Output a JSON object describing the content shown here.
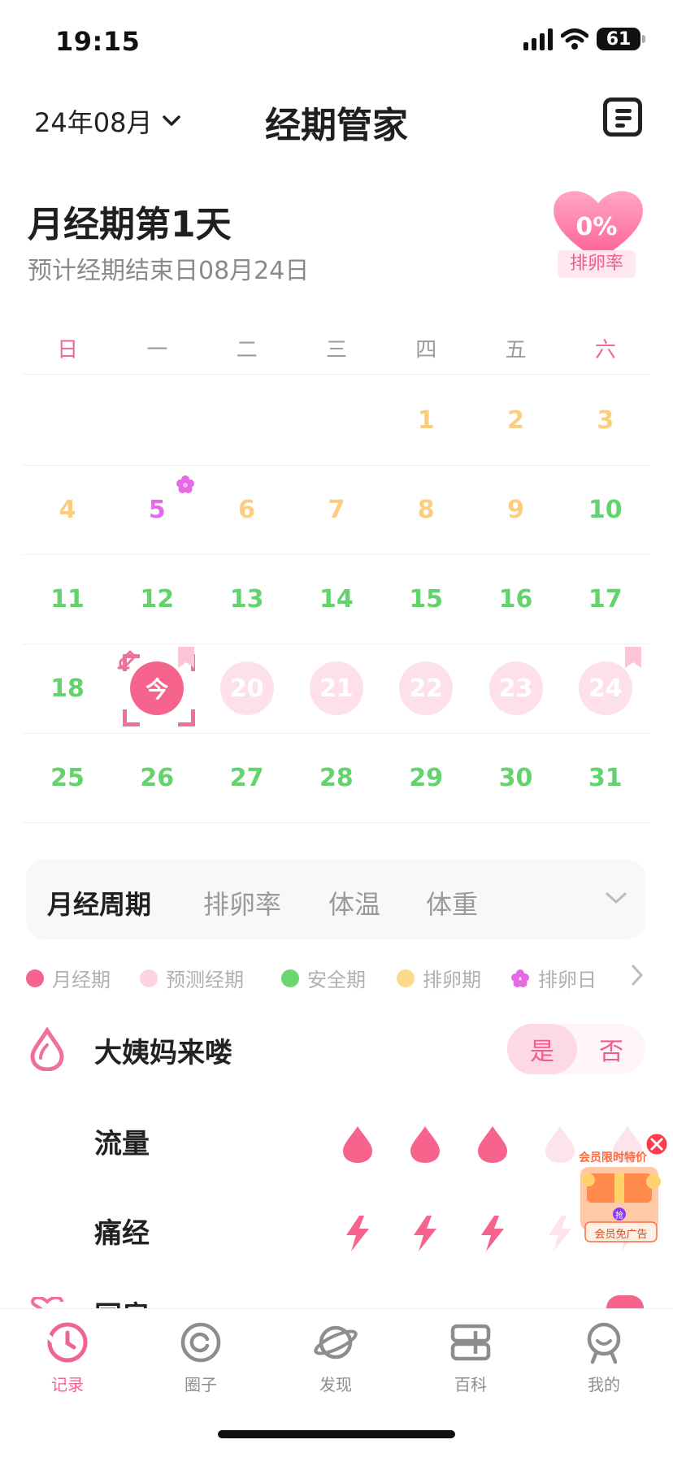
{
  "status_bar": {
    "time": "19:15",
    "battery": "61"
  },
  "header": {
    "month": "24年08月",
    "title": "经期管家"
  },
  "status": {
    "day_status": "月经期第1天",
    "end_date": "预计经期结束日08月24日",
    "ovulation_rate": "0%",
    "ovulation_label": "排卵率"
  },
  "weekdays": [
    "日",
    "一",
    "二",
    "三",
    "四",
    "五",
    "六"
  ],
  "calendar": {
    "weeks": [
      [
        {
          "d": ""
        },
        {
          "d": ""
        },
        {
          "d": ""
        },
        {
          "d": ""
        },
        {
          "d": "1",
          "t": "ovulation"
        },
        {
          "d": "2",
          "t": "ovulation"
        },
        {
          "d": "3",
          "t": "ovulation"
        }
      ],
      [
        {
          "d": "4",
          "t": "ovulation"
        },
        {
          "d": "5",
          "t": "ovulation-day"
        },
        {
          "d": "6",
          "t": "ovulation"
        },
        {
          "d": "7",
          "t": "ovulation"
        },
        {
          "d": "8",
          "t": "ovulation"
        },
        {
          "d": "9",
          "t": "ovulation"
        },
        {
          "d": "10",
          "t": "safe"
        }
      ],
      [
        {
          "d": "11",
          "t": "safe"
        },
        {
          "d": "12",
          "t": "safe"
        },
        {
          "d": "13",
          "t": "safe"
        },
        {
          "d": "14",
          "t": "safe"
        },
        {
          "d": "15",
          "t": "safe"
        },
        {
          "d": "16",
          "t": "safe"
        },
        {
          "d": "17",
          "t": "safe"
        }
      ],
      [
        {
          "d": "18",
          "t": "safe"
        },
        {
          "d": "今",
          "t": "today"
        },
        {
          "d": "20",
          "t": "predicted"
        },
        {
          "d": "21",
          "t": "predicted"
        },
        {
          "d": "22",
          "t": "predicted"
        },
        {
          "d": "23",
          "t": "predicted"
        },
        {
          "d": "24",
          "t": "predicted"
        }
      ],
      [
        {
          "d": "25",
          "t": "safe"
        },
        {
          "d": "26",
          "t": "safe"
        },
        {
          "d": "27",
          "t": "safe"
        },
        {
          "d": "28",
          "t": "safe"
        },
        {
          "d": "29",
          "t": "safe"
        },
        {
          "d": "30",
          "t": "safe"
        },
        {
          "d": "31",
          "t": "safe"
        }
      ]
    ]
  },
  "tabs": [
    "月经周期",
    "排卵率",
    "体温",
    "体重"
  ],
  "legend": [
    {
      "label": "月经期",
      "color": "#f6648e"
    },
    {
      "label": "预测经期",
      "color": "#fcd3e0"
    },
    {
      "label": "安全期",
      "color": "#6ad66f"
    },
    {
      "label": "排卵期",
      "color": "#fdd98c"
    },
    {
      "label": "排卵日",
      "color": "#e46ae6"
    }
  ],
  "period_row": {
    "label": "大姨妈来喽",
    "yes": "是",
    "no": "否"
  },
  "flow": {
    "label": "流量",
    "level": 3,
    "max": 5
  },
  "cramps": {
    "label": "痛经",
    "level": 3,
    "max": 5
  },
  "partial_row": {
    "label": "同房"
  },
  "promo": {
    "headline": "会员限时特价",
    "grab": "抢",
    "badge": "会员免广告"
  },
  "nav": [
    {
      "label": "记录",
      "icon": "clock-icon"
    },
    {
      "label": "圈子",
      "icon": "circle-icon"
    },
    {
      "label": "发现",
      "icon": "planet-icon"
    },
    {
      "label": "百科",
      "icon": "book-icon"
    },
    {
      "label": "我的",
      "icon": "face-icon"
    }
  ]
}
